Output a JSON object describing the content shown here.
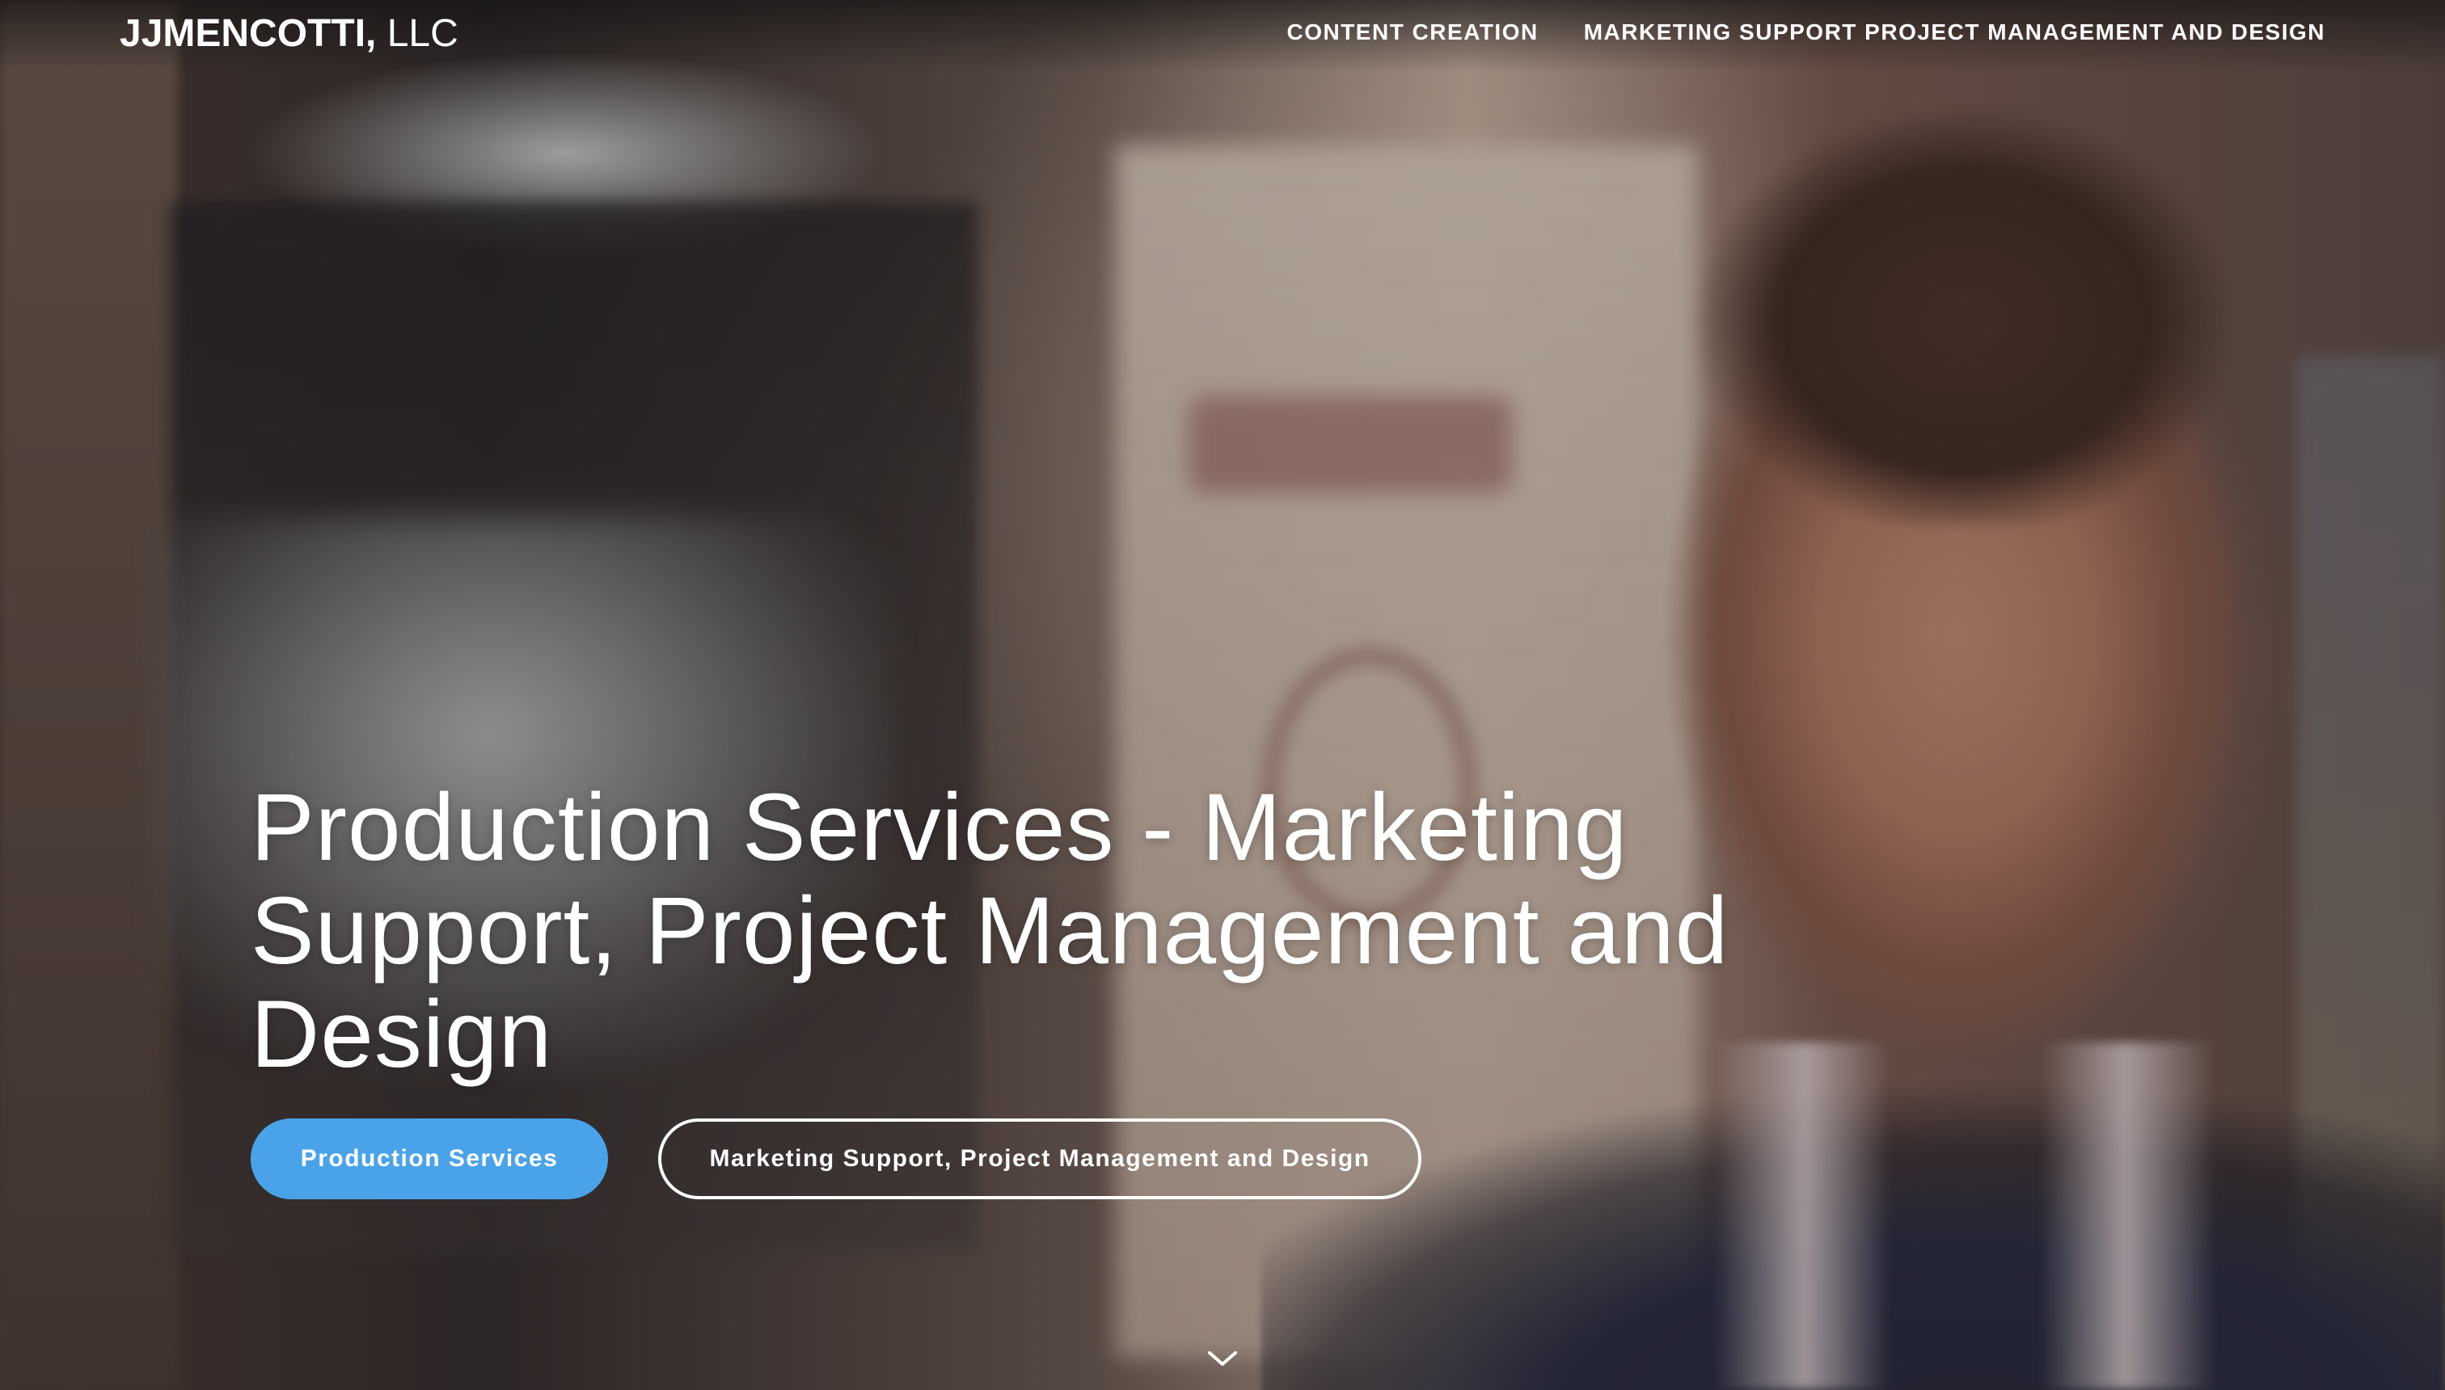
{
  "nav": {
    "brand_bold": "JJMENCOTTI,",
    "brand_light": " LLC",
    "links": [
      {
        "label": "CONTENT CREATION"
      },
      {
        "label": "MARKETING SUPPORT PROJECT MANAGEMENT AND DESIGN"
      }
    ]
  },
  "hero": {
    "title": "Production Services - Marketing Support, Project Management and Design",
    "buttons": {
      "primary_label": "Production Services",
      "secondary_label": "Marketing Support, Project Management and Design"
    },
    "scroll_icon": "chevron-down-icon"
  },
  "colors": {
    "accent": "#4aa3e8",
    "text": "#ffffff"
  }
}
